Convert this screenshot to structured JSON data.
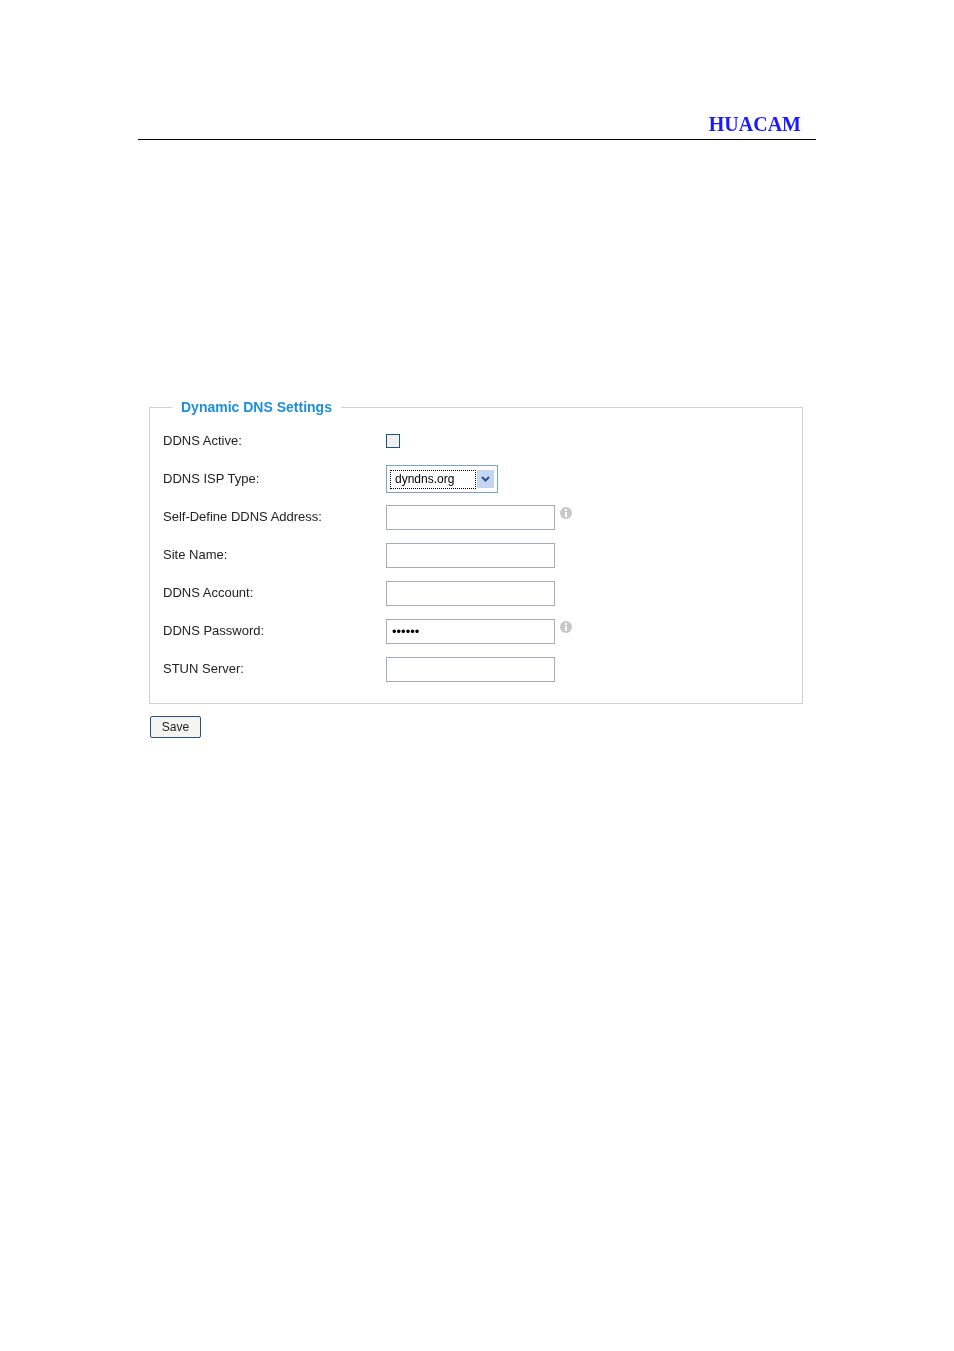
{
  "header": {
    "brand": "HUACAM"
  },
  "fieldset": {
    "legend": "Dynamic DNS Settings",
    "fields": [
      {
        "kind": "checkbox",
        "label": "DDNS Active:",
        "checked": false
      },
      {
        "kind": "select",
        "label": "DDNS ISP Type:",
        "value": "dyndns.org"
      },
      {
        "kind": "text",
        "label": "Self-Define DDNS Address:",
        "info": true
      },
      {
        "kind": "text",
        "label": "Site Name:",
        "info": false
      },
      {
        "kind": "text",
        "label": "DDNS Account:",
        "info": false
      },
      {
        "kind": "text",
        "label": "DDNS Password:",
        "value": "••••••",
        "info": true
      },
      {
        "kind": "text",
        "label": "STUN Server:",
        "info": false
      }
    ]
  },
  "buttons": [
    "Save"
  ]
}
